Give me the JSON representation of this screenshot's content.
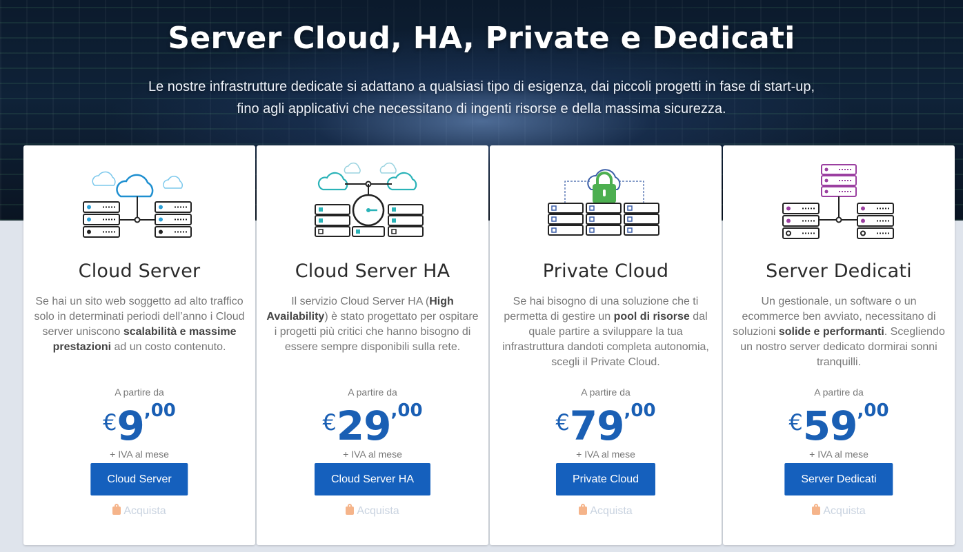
{
  "hero": {
    "title": "Server Cloud, HA, Private e Dedicati",
    "subtitle_line1": "Le nostre infrastrutture dedicate si adattano a qualsiasi tipo di esigenza, dai piccoli progetti in fase di start-up,",
    "subtitle_line2": "fino agli applicativi che necessitano di ingenti risorse e della massima sicurezza."
  },
  "cards": [
    {
      "title": "Cloud Server",
      "desc": [
        "Se hai un sito web soggetto ad alto traffico solo in determinati periodi dell’anno i Cloud server uniscono ",
        "scalabilità e massime prestazioni",
        " ad un costo contenuto."
      ],
      "from_label": "A partire da",
      "currency": "€",
      "price_int": "9",
      "price_dec": ",00",
      "vat_label": "+ IVA al mese",
      "button": "Cloud Server",
      "buy": "Acquista",
      "icon": "cloud-server-illustration",
      "accent": "#2b9fd6"
    },
    {
      "title": "Cloud Server HA",
      "desc": [
        "Il servizio Cloud Server HA (",
        "High Availability",
        ") è stato progettato per ospitare i progetti più critici che hanno bisogno di essere sempre disponibili sulla rete."
      ],
      "from_label": "A partire da",
      "currency": "€",
      "price_int": "29",
      "price_dec": ",00",
      "vat_label": "+ IVA al mese",
      "button": "Cloud Server HA",
      "buy": "Acquista",
      "icon": "high-availability-gauge-illustration",
      "accent": "#2ab3b8"
    },
    {
      "title": "Private Cloud",
      "desc": [
        "Se hai bisogno di una soluzione che ti permetta di gestire un ",
        "pool di risorse",
        " dal quale partire a sviluppare la tua infrastruttura dandoti completa autonomia, scegli il Private Cloud."
      ],
      "from_label": "A partire da",
      "currency": "€",
      "price_int": "79",
      "price_dec": ",00",
      "vat_label": "+ IVA al mese",
      "button": "Private Cloud",
      "buy": "Acquista",
      "icon": "private-cloud-lock-illustration",
      "accent": "#4caf50"
    },
    {
      "title": "Server Dedicati",
      "desc": [
        "Un gestionale, un software o un ecommerce ben avviato, necessitano di soluzioni ",
        "solide e performanti",
        ". Scegliendo un nostro server dedicato dormirai sonni tranquilli."
      ],
      "from_label": "A partire da",
      "currency": "€",
      "price_int": "59",
      "price_dec": ",00",
      "vat_label": "+ IVA al mese",
      "button": "Server Dedicati",
      "buy": "Acquista",
      "icon": "dedicated-server-illustration",
      "accent": "#9b3fa0"
    }
  ]
}
